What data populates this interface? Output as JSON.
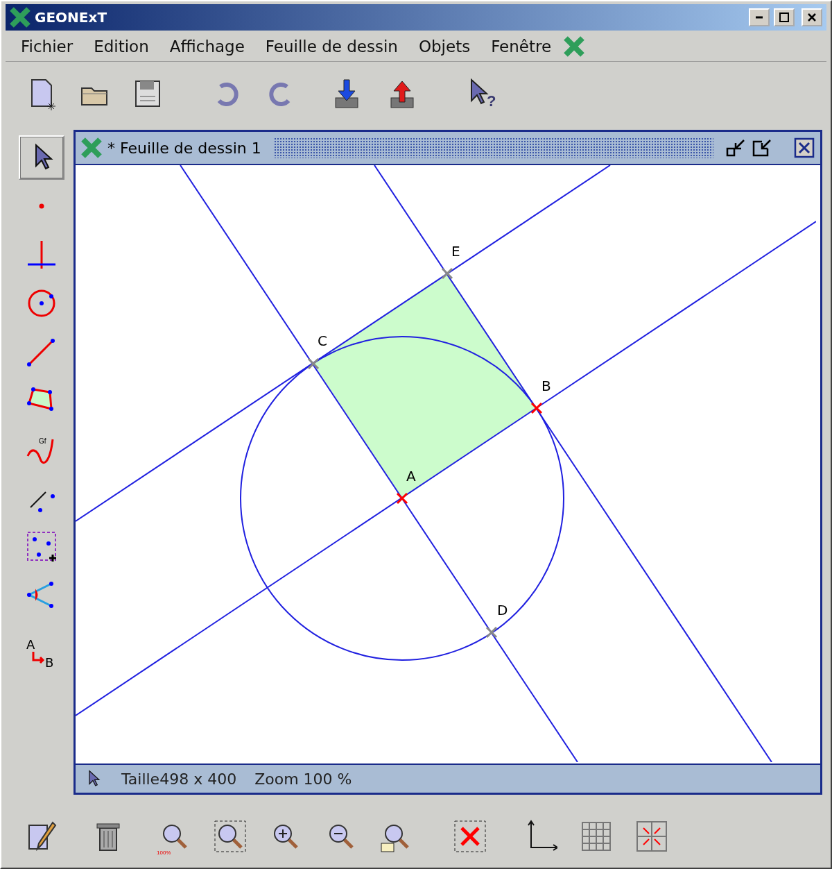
{
  "window": {
    "title": "GEONExT"
  },
  "menu": [
    "Fichier",
    "Edition",
    "Affichage",
    "Feuille de dessin",
    "Objets",
    "Fenêtre"
  ],
  "toolbar": {
    "help_glyph": "?"
  },
  "tools": [
    {
      "selected": true
    },
    {
      "selected": false
    },
    {
      "selected": false
    },
    {
      "selected": false
    },
    {
      "selected": false
    },
    {
      "selected": false
    },
    {
      "selected": false,
      "glyphs": [
        "Gf"
      ]
    },
    {
      "selected": false
    },
    {
      "selected": false
    },
    {
      "selected": false
    },
    {
      "selected": false,
      "glyphs": [
        "A",
        "B"
      ]
    }
  ],
  "sheet": {
    "title": "* Feuille de dessin 1",
    "points": [
      {
        "label": "E",
        "kind": "intersection"
      },
      {
        "label": "C",
        "kind": "intersection"
      },
      {
        "label": "B",
        "kind": "free"
      },
      {
        "label": "A",
        "kind": "free"
      },
      {
        "label": "D",
        "kind": "intersection"
      }
    ],
    "status": {
      "size": "Taille498 x 400",
      "zoom": "Zoom 100 %"
    }
  },
  "bottom_tools": [
    {
      "label": "100%"
    }
  ]
}
